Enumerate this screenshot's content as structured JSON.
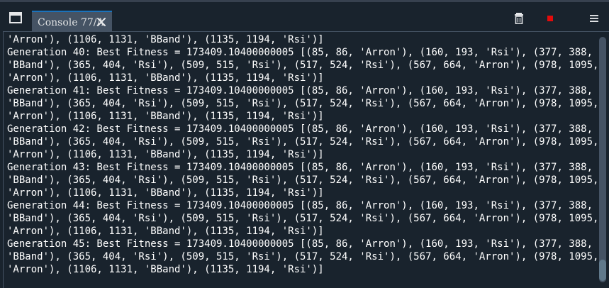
{
  "tab": {
    "label": "Console 77/A"
  },
  "icons": {
    "browse_tabs": "window-icon",
    "close": "close-icon",
    "clear": "trash-icon",
    "stop": "stop-icon",
    "options": "hamburger-menu-icon"
  },
  "colors": {
    "background": "#19232d",
    "tab_background": "#455364",
    "tab_accent": "#1a72bb",
    "stop_button": "#e30b0b",
    "text": "#ffffff"
  },
  "console": {
    "lines": [
      "'Arron'), (1106, 1131, 'BBand'), (1135, 1194, 'Rsi')]",
      "Generation 40: Best Fitness = 173409.10400000005 [(85, 86, 'Arron'), (160, 193, 'Rsi'), (377, 388,",
      "'BBand'), (365, 404, 'Rsi'), (509, 515, 'Rsi'), (517, 524, 'Rsi'), (567, 664, 'Arron'), (978, 1095,",
      "'Arron'), (1106, 1131, 'BBand'), (1135, 1194, 'Rsi')]",
      "Generation 41: Best Fitness = 173409.10400000005 [(85, 86, 'Arron'), (160, 193, 'Rsi'), (377, 388,",
      "'BBand'), (365, 404, 'Rsi'), (509, 515, 'Rsi'), (517, 524, 'Rsi'), (567, 664, 'Arron'), (978, 1095,",
      "'Arron'), (1106, 1131, 'BBand'), (1135, 1194, 'Rsi')]",
      "Generation 42: Best Fitness = 173409.10400000005 [(85, 86, 'Arron'), (160, 193, 'Rsi'), (377, 388,",
      "'BBand'), (365, 404, 'Rsi'), (509, 515, 'Rsi'), (517, 524, 'Rsi'), (567, 664, 'Arron'), (978, 1095,",
      "'Arron'), (1106, 1131, 'BBand'), (1135, 1194, 'Rsi')]",
      "Generation 43: Best Fitness = 173409.10400000005 [(85, 86, 'Arron'), (160, 193, 'Rsi'), (377, 388,",
      "'BBand'), (365, 404, 'Rsi'), (509, 515, 'Rsi'), (517, 524, 'Rsi'), (567, 664, 'Arron'), (978, 1095,",
      "'Arron'), (1106, 1131, 'BBand'), (1135, 1194, 'Rsi')]",
      "Generation 44: Best Fitness = 173409.10400000005 [(85, 86, 'Arron'), (160, 193, 'Rsi'), (377, 388,",
      "'BBand'), (365, 404, 'Rsi'), (509, 515, 'Rsi'), (517, 524, 'Rsi'), (567, 664, 'Arron'), (978, 1095,",
      "'Arron'), (1106, 1131, 'BBand'), (1135, 1194, 'Rsi')]",
      "Generation 45: Best Fitness = 173409.10400000005 [(85, 86, 'Arron'), (160, 193, 'Rsi'), (377, 388,",
      "'BBand'), (365, 404, 'Rsi'), (509, 515, 'Rsi'), (517, 524, 'Rsi'), (567, 664, 'Arron'), (978, 1095,",
      "'Arron'), (1106, 1131, 'BBand'), (1135, 1194, 'Rsi')]"
    ]
  }
}
